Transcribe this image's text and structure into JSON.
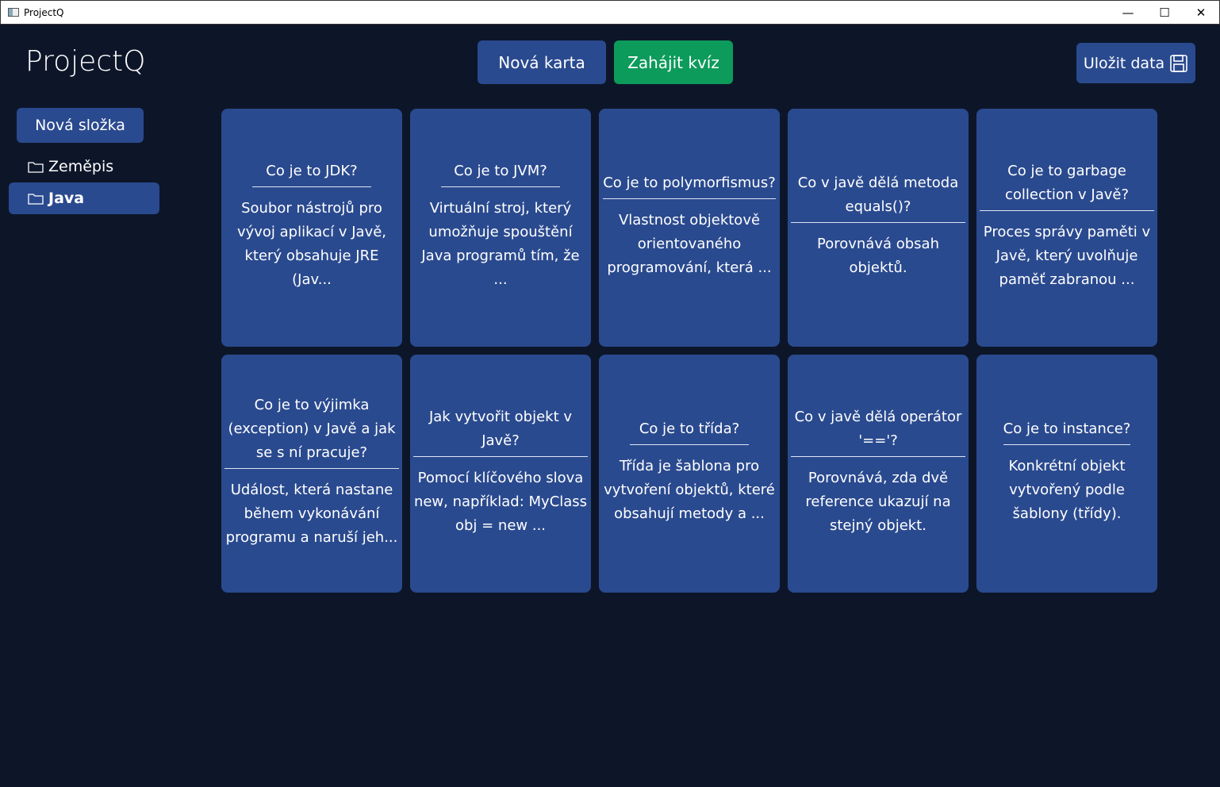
{
  "window": {
    "title": "ProjectQ",
    "controls": {
      "minimize": "—",
      "maximize": "☐",
      "close": "✕"
    }
  },
  "app": {
    "brand": "ProjectQ"
  },
  "toolbar": {
    "new_card": "Nová karta",
    "start_quiz": "Zahájit kvíz",
    "save": "Uložit data"
  },
  "sidebar": {
    "new_folder": "Nová složka",
    "folders": [
      {
        "label": "Zeměpis",
        "active": false
      },
      {
        "label": "Java",
        "active": true
      }
    ]
  },
  "colors": {
    "background": "#0d1629",
    "primary": "#2a4a8f",
    "success": "#0d9b5b"
  },
  "cards": [
    {
      "question": "Co je to JDK?",
      "answer": "Soubor nástrojů pro vývoj aplikací v Javě, který obsahuje JRE (Jav..."
    },
    {
      "question": "Co je to JVM?",
      "answer": "Virtuální stroj, který umožňuje spouštění Java programů tím, že ..."
    },
    {
      "question": "Co je to polymorfismus?",
      "answer": "Vlastnost objektově orientovaného programování, která ..."
    },
    {
      "question": "Co v javě dělá metoda equals()?",
      "answer": "Porovnává obsah objektů."
    },
    {
      "question": "Co je to garbage collection v Javě?",
      "answer": "Proces správy paměti v Javě, který uvolňuje paměť zabranou ..."
    },
    {
      "question": "Co je to výjimka (exception) v Javě a jak se s ní pracuje?",
      "answer": "Událost, která nastane během vykonávání programu a naruší jeh..."
    },
    {
      "question": "Jak vytvořit objekt v Javě?",
      "answer": "Pomocí klíčového slova new, například: MyClass obj = new ..."
    },
    {
      "question": "Co je to třída?",
      "answer": "Třída je šablona pro vytvoření objektů, které obsahují metody a ..."
    },
    {
      "question": "Co v javě dělá operátor '=='?",
      "answer": "Porovnává, zda dvě reference ukazují na stejný objekt."
    },
    {
      "question": "Co je to instance?",
      "answer": "Konkrétní objekt vytvořený podle šablony (třídy)."
    }
  ]
}
